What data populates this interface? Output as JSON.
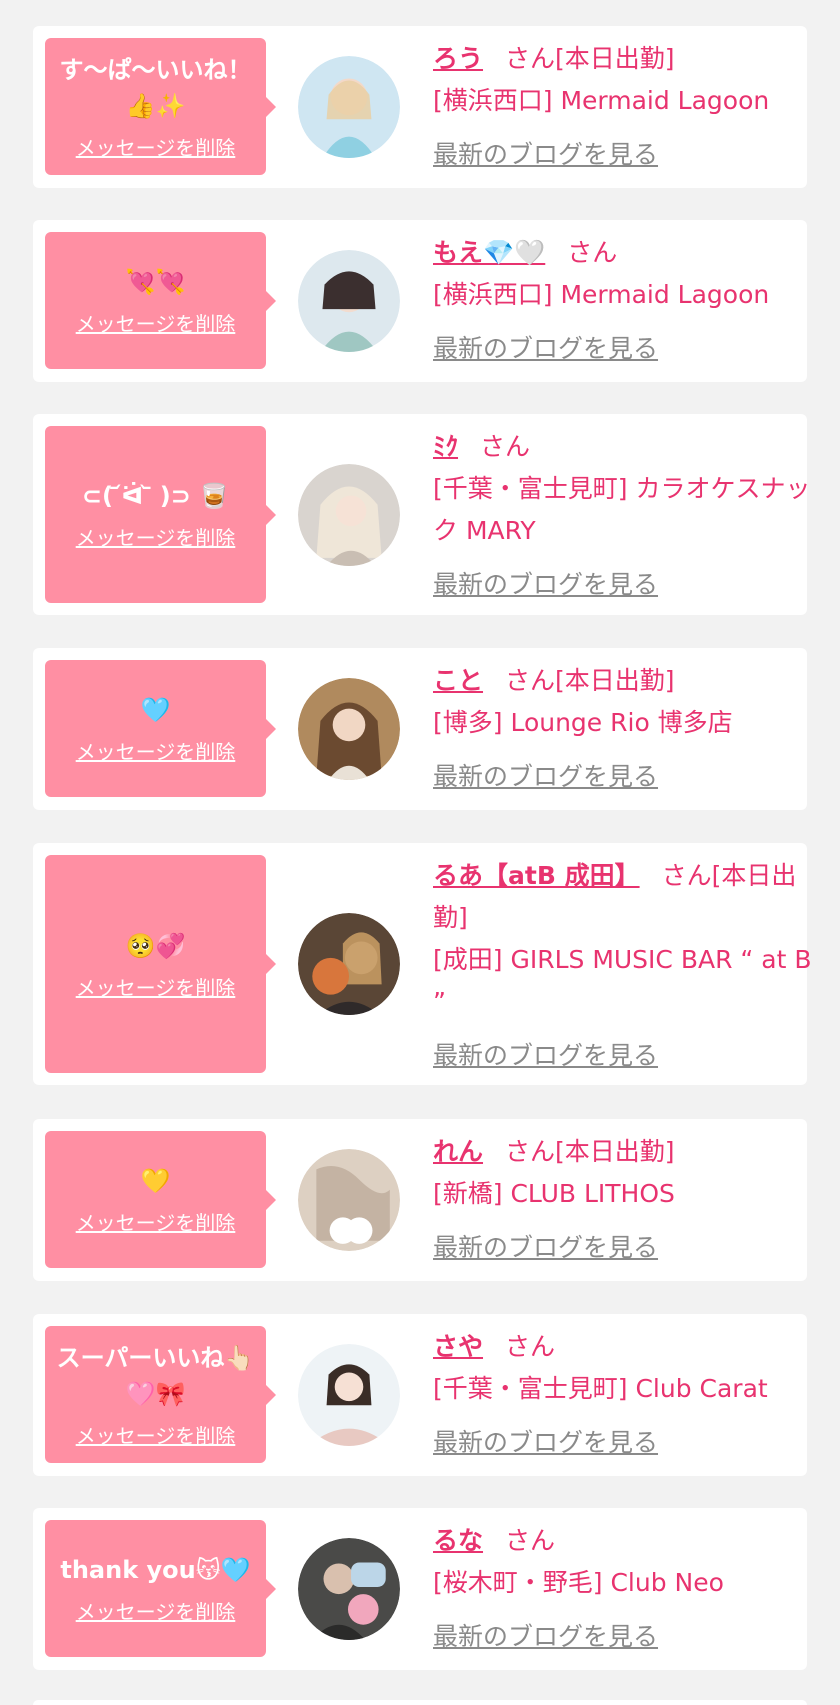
{
  "delete_label": "メッセージを削除",
  "san_label": "さん",
  "blog_label": "最新のブログを見る",
  "colors": {
    "accent": "#e8336f",
    "bubble": "#ff8fa3",
    "blog_link": "#8a8a8a",
    "background": "#f2f2f2"
  },
  "items": [
    {
      "message": "す〜ぱ〜いいね！👍✨",
      "name": "ろう",
      "badge": "[本日出勤]",
      "shop": "[横浜西口] Mermaid Lagoon",
      "avatar_icon": "avatar-photo"
    },
    {
      "message": "💘💘",
      "name": "もえ💎🤍",
      "badge": "",
      "shop": "[横浜西口] Mermaid Lagoon",
      "avatar_icon": "avatar-photo"
    },
    {
      "message": "⊂( ᷄ᐛ ᷅ )⊃ 🥃",
      "name": "ﾐｸ",
      "badge": "",
      "shop": "[千葉・富士見町] カラオケスナック MARY",
      "avatar_icon": "avatar-photo"
    },
    {
      "message": "🩵",
      "name": "こと",
      "badge": "[本日出勤]",
      "shop": "[博多] Lounge Rio 博多店",
      "avatar_icon": "avatar-photo"
    },
    {
      "message": "🥺💞",
      "name": "るあ【atB 成田】",
      "badge": "[本日出勤]",
      "shop": "[成田] GIRLS MUSIC BAR “ at B ”",
      "avatar_icon": "avatar-photo"
    },
    {
      "message": "💛",
      "name": "れん",
      "badge": "[本日出勤]",
      "shop": "[新橋] CLUB LITHOS",
      "avatar_icon": "avatar-photo"
    },
    {
      "message": "スーパーいいね👆🏻🩷🎀",
      "name": "さや",
      "badge": "",
      "shop": "[千葉・富士見町] Club Carat",
      "avatar_icon": "avatar-photo"
    },
    {
      "message": "thank you😽🩵",
      "name": "るな",
      "badge": "",
      "shop": "[桜木町・野毛] Club Neo",
      "avatar_icon": "avatar-photo"
    }
  ]
}
